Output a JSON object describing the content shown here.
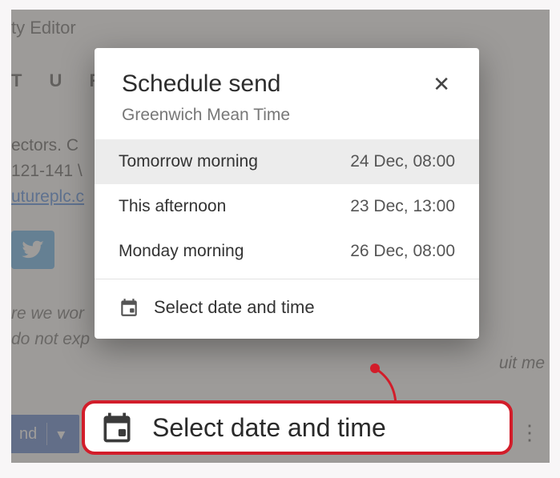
{
  "background": {
    "header_fragment": "ty Editor",
    "subtitle_letters": "T U R",
    "line1_fragment": "ectors. C",
    "line2_fragment": "121-141 \\",
    "link_fragment": "utureplc.c",
    "italic_line1": "re we wor",
    "italic_line2": "do not exp",
    "right_italic_fragment": "uit me",
    "send_button_fragment": "nd",
    "caret": "▾"
  },
  "dialog": {
    "title": "Schedule send",
    "subtitle": "Greenwich Mean Time",
    "options": [
      {
        "label": "Tomorrow morning",
        "time": "24 Dec, 08:00"
      },
      {
        "label": "This afternoon",
        "time": "23 Dec, 13:00"
      },
      {
        "label": "Monday morning",
        "time": "26 Dec, 08:00"
      }
    ],
    "custom_label": "Select date and time"
  },
  "callout": {
    "text": "Select date and time"
  }
}
